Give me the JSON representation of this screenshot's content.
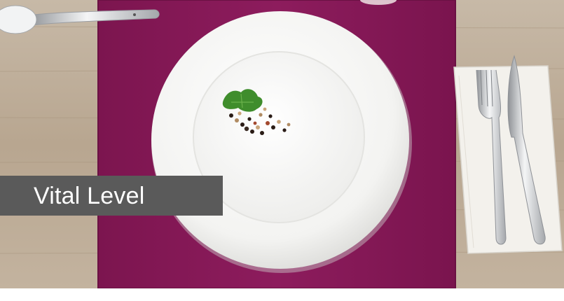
{
  "caption": {
    "title": "Vital Level"
  },
  "scene": {
    "background": "wooden-table",
    "placemat_color": "#8a1a5a",
    "plate_color": "#f7f7f5",
    "napkin_color": "#f3f1ec",
    "caption_bar_color": "#5a5a5a",
    "objects": [
      "plate",
      "parsley-leaf",
      "peppercorns",
      "spoon",
      "fork",
      "knife",
      "napkin",
      "placemat"
    ]
  }
}
